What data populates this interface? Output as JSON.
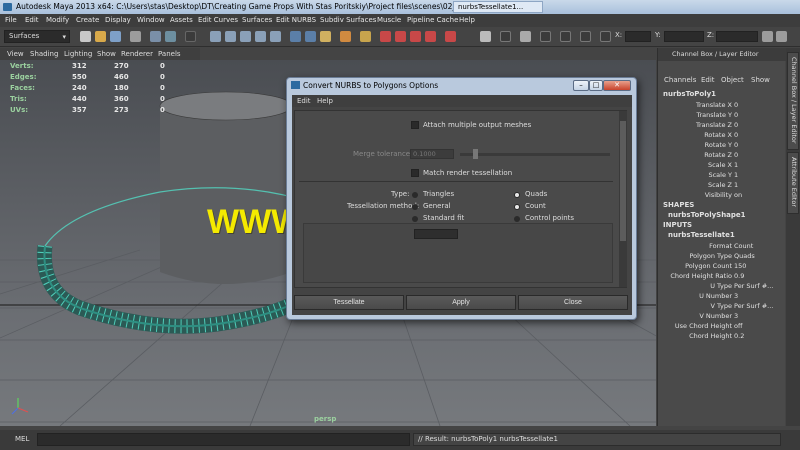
{
  "window": {
    "title": "Autodesk Maya 2013 x64: C:\\Users\\stas\\Desktop\\DT\\Creating Game Props With Stas Poritskiy\\Project files\\scenes\\02_start.ma*",
    "tab_label": "nurbsTessellate1..."
  },
  "menubar": {
    "items": [
      "File",
      "Edit",
      "Modify",
      "Create",
      "Display",
      "Window",
      "Assets",
      "Edit Curves",
      "Surfaces",
      "Edit NURBS",
      "Subdiv Surfaces",
      "Muscle",
      "Pipeline Cache",
      "Help"
    ]
  },
  "statusline": {
    "mode": "Surfaces",
    "coord_labels": [
      "X:",
      "Y:",
      "Z:"
    ]
  },
  "panel_menu": {
    "items": [
      "View",
      "Shading",
      "Lighting",
      "Show",
      "Renderer",
      "Panels"
    ]
  },
  "hud": {
    "rows": [
      {
        "label": "Verts:",
        "v1": "312",
        "v2": "270",
        "v3": "0"
      },
      {
        "label": "Edges:",
        "v1": "550",
        "v2": "460",
        "v3": "0"
      },
      {
        "label": "Faces:",
        "v1": "240",
        "v2": "180",
        "v3": "0"
      },
      {
        "label": "Tris:",
        "v1": "440",
        "v2": "360",
        "v3": "0"
      },
      {
        "label": "UVs:",
        "v1": "357",
        "v2": "273",
        "v3": "0"
      }
    ],
    "camera": "persp"
  },
  "watermark": "WWW.CGTSJ.COM",
  "channel_box": {
    "header": "Channel Box / Layer Editor",
    "tabs": [
      "Channels",
      "Edit",
      "Object",
      "Show"
    ],
    "node": "nurbsToPoly1",
    "transform_attrs": [
      {
        "name": "Translate X",
        "value": "0"
      },
      {
        "name": "Translate Y",
        "value": "0"
      },
      {
        "name": "Translate Z",
        "value": "0"
      },
      {
        "name": "Rotate X",
        "value": "0"
      },
      {
        "name": "Rotate Y",
        "value": "0"
      },
      {
        "name": "Rotate Z",
        "value": "0"
      },
      {
        "name": "Scale X",
        "value": "1"
      },
      {
        "name": "Scale Y",
        "value": "1"
      },
      {
        "name": "Scale Z",
        "value": "1"
      },
      {
        "name": "Visibility",
        "value": "on"
      }
    ],
    "shapes_label": "SHAPES",
    "shape_node": "nurbsToPolyShape1",
    "inputs_label": "INPUTS",
    "input_node": "nurbsTessellate1",
    "input_attrs": [
      {
        "name": "Format",
        "value": "Count"
      },
      {
        "name": "Polygon Type",
        "value": "Quads"
      },
      {
        "name": "Polygon Count",
        "value": "150"
      },
      {
        "name": "Chord Height Ratio",
        "value": "0.9"
      },
      {
        "name": "U Type",
        "value": "Per Surf #..."
      },
      {
        "name": "U Number",
        "value": "3"
      },
      {
        "name": "V Type",
        "value": "Per Surf #..."
      },
      {
        "name": "V Number",
        "value": "3"
      },
      {
        "name": "Use Chord Height",
        "value": "off"
      },
      {
        "name": "Chord Height",
        "value": "0.2"
      }
    ]
  },
  "side_tabs": [
    "Channel Box / Layer Editor",
    "Attribute Editor"
  ],
  "command_line": {
    "label": "MEL",
    "result": "// Result: nurbsToPoly1 nurbsTessellate1"
  },
  "dialog": {
    "title": "Convert NURBS to Polygons Options",
    "menu": [
      "Edit",
      "Help"
    ],
    "attach_label": "Attach multiple output meshes",
    "merge_label": "Merge tolerance:",
    "merge_value": "0.1000",
    "match_label": "Match render tessellation",
    "type_label": "Type:",
    "type_options": [
      "Triangles",
      "Quads"
    ],
    "type_selected": "Quads",
    "method_label": "Tessellation method:",
    "method_options": [
      "General",
      "Count",
      "Standard fit",
      "Control points"
    ],
    "method_selected": "Count",
    "buttons": [
      "Tessellate",
      "Apply",
      "Close"
    ]
  }
}
